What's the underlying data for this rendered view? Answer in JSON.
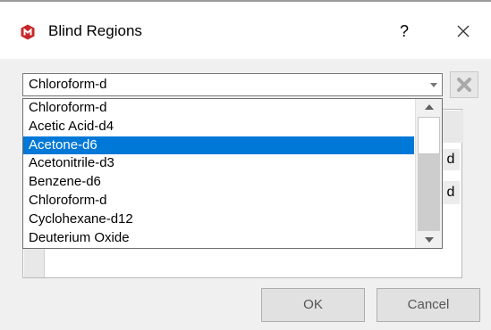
{
  "window": {
    "title": "Blind Regions",
    "help_label": "?",
    "app_icon": "mnova-logo-icon",
    "close_icon": "close-icon"
  },
  "solvent_combo": {
    "value": "Chloroform-d",
    "arrow_icon": "chevron-down-icon"
  },
  "remove_button": {
    "icon": "remove-x-icon",
    "enabled": false
  },
  "dropdown": {
    "items": [
      "Chloroform-d",
      "Acetic Acid-d4",
      "Acetone-d6",
      "Acetonitrile-d3",
      "Benzene-d6",
      "Chloroform-d",
      "Cyclohexane-d12",
      "Deuterium Oxide"
    ],
    "selected_index": 2
  },
  "table": {
    "partial_cells": [
      "d",
      "d"
    ]
  },
  "buttons": {
    "ok": "OK",
    "cancel": "Cancel"
  },
  "colors": {
    "selection": "#0078d7",
    "dialog_bg": "#f0f0f0",
    "icon_red": "#c8282a"
  }
}
